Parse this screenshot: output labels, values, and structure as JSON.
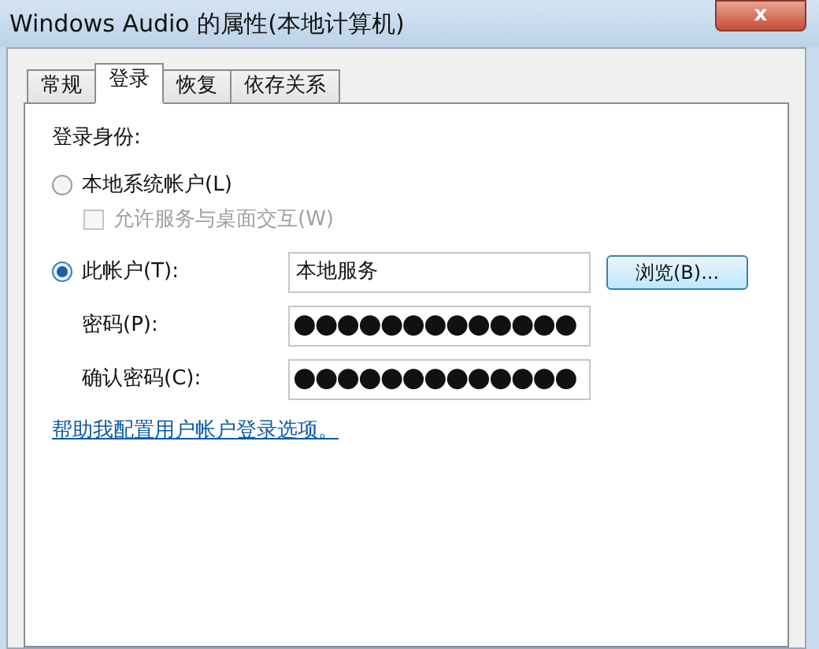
{
  "window": {
    "title": "Windows Audio 的属性(本地计算机)",
    "close": "x"
  },
  "tabs": [
    {
      "label": "常规",
      "selected": false
    },
    {
      "label": "登录",
      "selected": true
    },
    {
      "label": "恢复",
      "selected": false
    },
    {
      "label": "依存关系",
      "selected": false
    }
  ],
  "logon_as": "登录身份:",
  "local_system": {
    "label": "本地系统帐户(L)",
    "selected": false
  },
  "interact": {
    "label": "允许服务与桌面交互(W)",
    "checked": false,
    "disabled": true
  },
  "this_account": {
    "label": "此帐户(T):",
    "selected": true,
    "value": "本地服务"
  },
  "browse": "浏览(B)...",
  "password": {
    "label": "密码(P):",
    "value": "●●●●●●●●●●●●●"
  },
  "confirm": {
    "label": "确认密码(C):",
    "value": "●●●●●●●●●●●●●"
  },
  "help_link": "帮助我配置用户帐户登录选项。"
}
